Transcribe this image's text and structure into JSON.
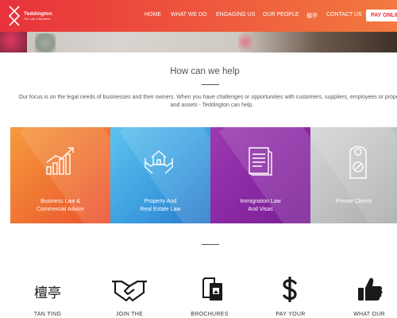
{
  "brand": {
    "name": "Teddington",
    "tagline": "The Law of Business"
  },
  "nav": {
    "home": "HOME",
    "what_we_do": "WHAT WE DO",
    "engaging_us": "ENGAGING US",
    "our_people": "OUR PEOPLE",
    "chinese": "檀亭",
    "contact_us": "CONTACT US",
    "pay_online": "PAY ONLINE"
  },
  "help": {
    "title": "How can we help",
    "intro": "Our focus is on the legal needs of businesses and their owners. When you have challenges or opportunities with customers, suppliers, employees or property and assets - Teddington can help."
  },
  "services": [
    {
      "label_line1": "Business Law &",
      "label_line2": "Commercial Advice",
      "icon": "growth-chart-icon"
    },
    {
      "label_line1": "Property And",
      "label_line2": "Real Estate Law",
      "icon": "house-in-hands-icon"
    },
    {
      "label_line1": "Immigration Law",
      "label_line2": "And Visas",
      "icon": "passport-icon"
    },
    {
      "label_line1": "Private Clients",
      "label_line2": "",
      "icon": "door-hanger-icon"
    }
  ],
  "quick_links": [
    {
      "label": "TAN TING",
      "icon": "chinese-characters-icon",
      "glyph": "檀亭"
    },
    {
      "label": "JOIN THE",
      "icon": "handshake-icon"
    },
    {
      "label": "BROCHURES",
      "icon": "documents-icon"
    },
    {
      "label": "PAY YOUR",
      "icon": "dollar-icon"
    },
    {
      "label": "WHAT OUR",
      "icon": "thumbs-up-icon"
    }
  ],
  "colors": {
    "header_start": "#e8323c",
    "header_end": "#f27a3f",
    "tile_business": "#f07a34",
    "tile_property": "#3fa3e2",
    "tile_immigration": "#8a2aa4",
    "tile_private": "#c0c2c4"
  }
}
